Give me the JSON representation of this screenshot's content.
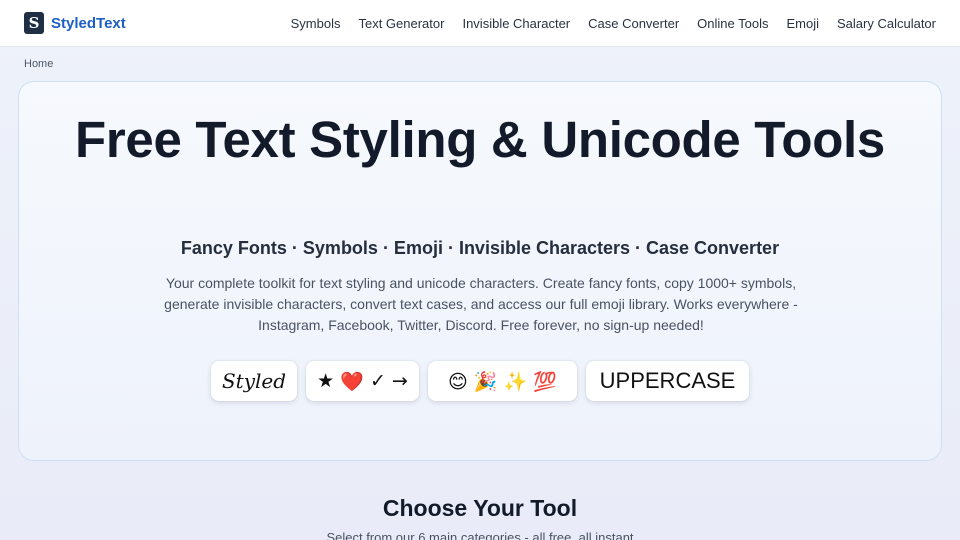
{
  "brand": {
    "logo_glyph": "S",
    "name": "StyledText",
    "accent_color": "#1d5fc4"
  },
  "nav": [
    "Symbols",
    "Text Generator",
    "Invisible Character",
    "Case Converter",
    "Online Tools",
    "Emoji",
    "Salary Calculator"
  ],
  "breadcrumb": {
    "home": "Home"
  },
  "hero": {
    "title": "Free Text Styling & Unicode Tools",
    "subtitle": "Fancy Fonts · Symbols · Emoji · Invisible Characters · Case Converter",
    "description": "Your complete toolkit for text styling and unicode characters. Create fancy fonts, copy 1000+ symbols, generate invisible characters, convert text cases, and access our full emoji library. Works everywhere - Instagram, Facebook, Twitter, Discord. Free forever, no sign-up needed!",
    "samples": {
      "styled": "Styled",
      "symbols_star": "★",
      "symbols_heart": "❤️",
      "symbols_check": "✓",
      "symbols_arrow": "→",
      "emoji": "😊 🎉 ✨ 💯",
      "uppercase": "UPPERCASE"
    }
  },
  "tools_section": {
    "title": "Choose Your Tool",
    "subtitle": "Select from our 6 main categories - all free, all instant"
  }
}
